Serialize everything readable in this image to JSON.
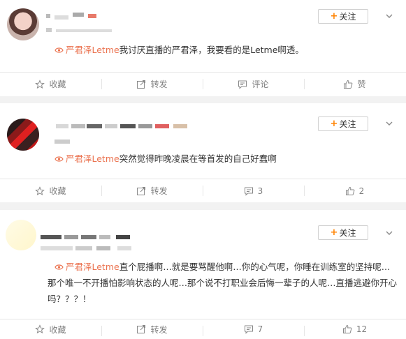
{
  "posts": [
    {
      "follow_label": "关注",
      "topic": "严君泽Letme",
      "text": "我讨厌直播的严君泽，我要看的是Letme啊透。",
      "actions": {
        "favorite": "收藏",
        "repost": "转发",
        "comment": "评论",
        "like": "赞"
      }
    },
    {
      "follow_label": "关注",
      "topic": "严君泽Letme",
      "text": "突然觉得昨晚凌晨在等首发的自己好蠢啊",
      "actions": {
        "favorite": "收藏",
        "repost": "转发",
        "comment": "3",
        "like": "2"
      }
    },
    {
      "follow_label": "关注",
      "topic": "严君泽Letme",
      "text": "直个屁播啊…就是要骂醒他啊…你的心气呢，你睡在训练室的坚持呢…那个唯一不开播怕影响状态的人呢…那个说不打职业会后悔一辈子的人呢…直播逃避你开心吗？？？！",
      "actions": {
        "favorite": "收藏",
        "repost": "转发",
        "comment": "7",
        "like": "12"
      }
    }
  ],
  "colors": {
    "accent": "#ff8200",
    "topic": "#eb7350",
    "action_text": "#808080"
  },
  "icons": [
    "plus-icon",
    "chevron-down-icon",
    "topic-icon",
    "star-icon",
    "repost-icon",
    "comment-icon",
    "like-icon"
  ]
}
